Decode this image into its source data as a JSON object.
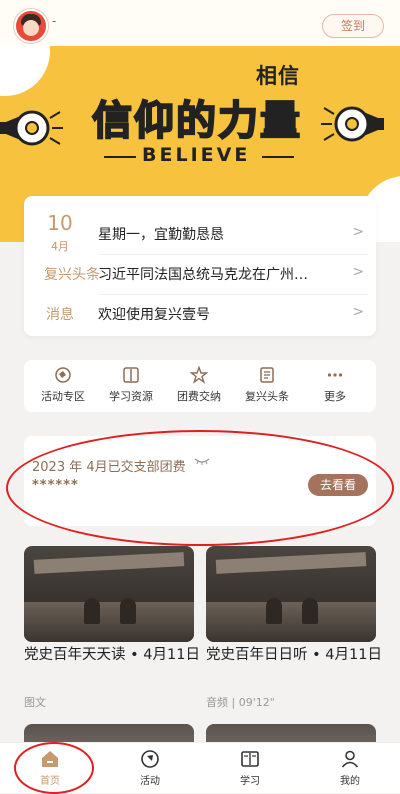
{
  "header": {
    "user_name": "-",
    "signin_label": "签到"
  },
  "banner": {
    "subtitle": "相信",
    "title": "信仰的力量",
    "english": "BELIEVE"
  },
  "info_card": {
    "day": "10",
    "month": "4月",
    "rows": [
      {
        "label": "",
        "text": "星期一，宜勤勤恳恳"
      },
      {
        "label": "复兴头条",
        "text": "习近平同法国总统马克龙在广州…"
      },
      {
        "label": "消息",
        "text": "欢迎使用复兴壹号"
      }
    ],
    "chevron": ">"
  },
  "shortcuts": [
    {
      "label": "活动专区",
      "icon": "activity-zone-icon"
    },
    {
      "label": "学习资源",
      "icon": "learning-resources-icon"
    },
    {
      "label": "团费交纳",
      "icon": "star-icon"
    },
    {
      "label": "复兴头条",
      "icon": "headlines-icon"
    },
    {
      "label": "更多",
      "icon": "more-dots-icon"
    }
  ],
  "fee_card": {
    "text": "2023 年 4月已交支部团费",
    "eye_icon": "hidden-eye-icon",
    "masked": "******",
    "button": "去看看"
  },
  "news": [
    {
      "title": "党史百年天天读 • 4月11日",
      "meta": "图文"
    },
    {
      "title": "党史百年日日听 • 4月11日",
      "meta": "音频 | 09'12\""
    }
  ],
  "tabbar": [
    {
      "label": "首页",
      "icon": "home-icon",
      "active": true
    },
    {
      "label": "活动",
      "icon": "activity-icon",
      "active": false
    },
    {
      "label": "学习",
      "icon": "study-book-icon",
      "active": false
    },
    {
      "label": "我的",
      "icon": "profile-icon",
      "active": false
    }
  ],
  "colors": {
    "accent": "#c49a72",
    "banner": "#f7c23e",
    "button": "#a5735b",
    "annotation": "#e02020"
  }
}
